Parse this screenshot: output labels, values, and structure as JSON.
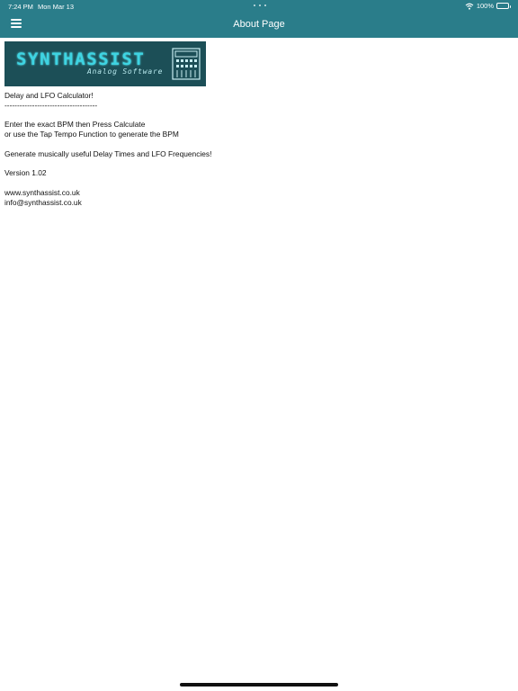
{
  "status_bar": {
    "time": "7:24 PM",
    "date": "Mon Mar 13",
    "battery": "100%"
  },
  "nav": {
    "title": "About Page",
    "menu_icon": "hamburger-menu-icon"
  },
  "logo": {
    "wordmark": "SYNTHASSIST",
    "tagline": "Analog Software"
  },
  "about": {
    "heading": "Delay and LFO Calculator!",
    "divider": "-------------------------------------",
    "instructions_1": "Enter the exact BPM then Press Calculate",
    "instructions_2": "or use the Tap Tempo Function to generate the BPM",
    "description": "Generate musically useful Delay Times and LFO Frequencies!",
    "version": "Version 1.02",
    "website": "www.synthassist.co.uk",
    "email": "info@synthassist.co.uk"
  },
  "colors": {
    "nav_background": "#2a7d8a",
    "logo_background": "#1c4f57",
    "logo_accent": "#3ed4e2"
  }
}
